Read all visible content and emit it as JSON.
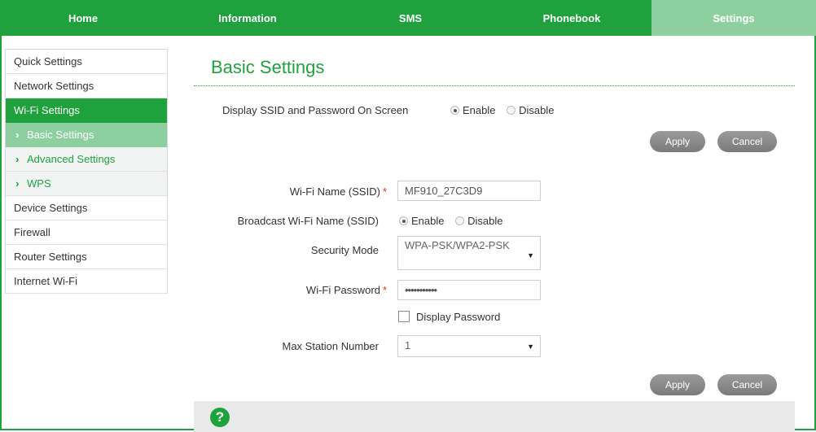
{
  "nav": {
    "home": "Home",
    "information": "Information",
    "sms": "SMS",
    "phonebook": "Phonebook",
    "settings": "Settings"
  },
  "sidebar": {
    "quick_settings": "Quick Settings",
    "network_settings": "Network Settings",
    "wifi_settings": "Wi-Fi Settings",
    "basic_settings": "Basic Settings",
    "advanced_settings": "Advanced Settings",
    "wps": "WPS",
    "device_settings": "Device Settings",
    "firewall": "Firewall",
    "router_settings": "Router Settings",
    "internet_wifi": "Internet Wi-Fi"
  },
  "page": {
    "title": "Basic Settings"
  },
  "display_ssid": {
    "label": "Display SSID and Password On Screen",
    "enable": "Enable",
    "disable": "Disable",
    "selected": "Enable"
  },
  "buttons": {
    "apply": "Apply",
    "cancel": "Cancel"
  },
  "form": {
    "ssid_label": "Wi-Fi Name (SSID)",
    "ssid_value": "MF910_27C3D9",
    "broadcast_label": "Broadcast Wi-Fi Name (SSID)",
    "broadcast_enable": "Enable",
    "broadcast_disable": "Disable",
    "broadcast_selected": "Enable",
    "security_label": "Security Mode",
    "security_value": "WPA-PSK/WPA2-PSK",
    "password_label": "Wi-Fi Password",
    "password_value": "•••••••••••",
    "display_password_label": "Display Password",
    "display_password_checked": false,
    "max_station_label": "Max Station Number",
    "max_station_value": "1",
    "required_mark": "*"
  },
  "icons": {
    "help": "help-icon",
    "dropdown": "chevron-down-icon",
    "submenu": "chevron-right-icon"
  },
  "colors": {
    "brand_green": "#1fa23d",
    "light_green": "#8ecfa0",
    "required_red": "#e0342a"
  }
}
